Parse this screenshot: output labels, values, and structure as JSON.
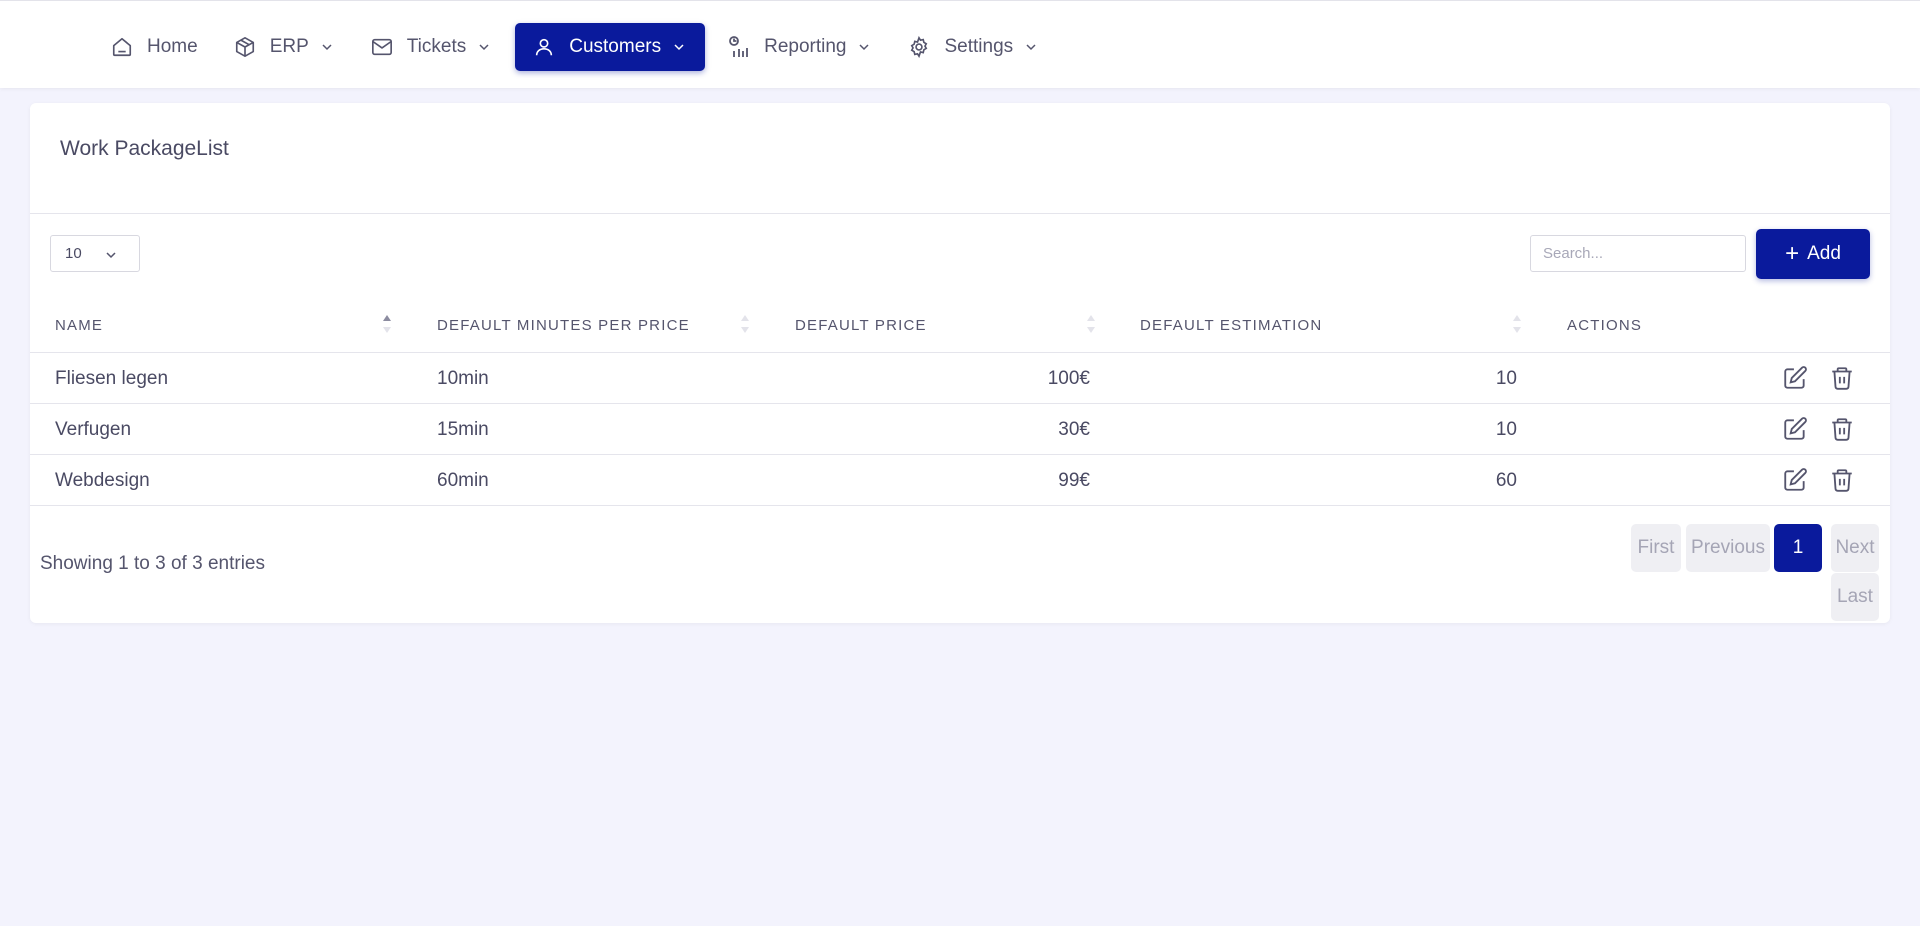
{
  "nav": {
    "items": [
      {
        "label": "Home",
        "icon": "home-icon",
        "dropdown": false,
        "active": false
      },
      {
        "label": "ERP",
        "icon": "box-icon",
        "dropdown": true,
        "active": false
      },
      {
        "label": "Tickets",
        "icon": "mail-icon",
        "dropdown": true,
        "active": false
      },
      {
        "label": "Customers",
        "icon": "user-icon",
        "dropdown": true,
        "active": true
      },
      {
        "label": "Reporting",
        "icon": "chart-icon",
        "dropdown": true,
        "active": false
      },
      {
        "label": "Settings",
        "icon": "gear-icon",
        "dropdown": true,
        "active": false
      }
    ]
  },
  "card": {
    "title": "Work PackageList"
  },
  "controls": {
    "page_length": "10",
    "search_placeholder": "Search...",
    "add_label": "Add"
  },
  "table": {
    "columns": [
      "NAME",
      "DEFAULT MINUTES PER PRICE",
      "DEFAULT PRICE",
      "DEFAULT ESTIMATION",
      "ACTIONS"
    ],
    "rows": [
      {
        "name": "Fliesen legen",
        "minutes": "10min",
        "price": "100€",
        "estimation": "10"
      },
      {
        "name": "Verfugen",
        "minutes": "15min",
        "price": "30€",
        "estimation": "10"
      },
      {
        "name": "Webdesign",
        "minutes": "60min",
        "price": "99€",
        "estimation": "60"
      }
    ]
  },
  "footer": {
    "info": "Showing 1 to 3 of 3 entries",
    "pagination": {
      "first": "First",
      "previous": "Previous",
      "current": "1",
      "next": "Next",
      "last": "Last"
    }
  },
  "colors": {
    "accent": "#0a1a9c",
    "background": "#f3f3fd",
    "text": "#4a4a63"
  }
}
